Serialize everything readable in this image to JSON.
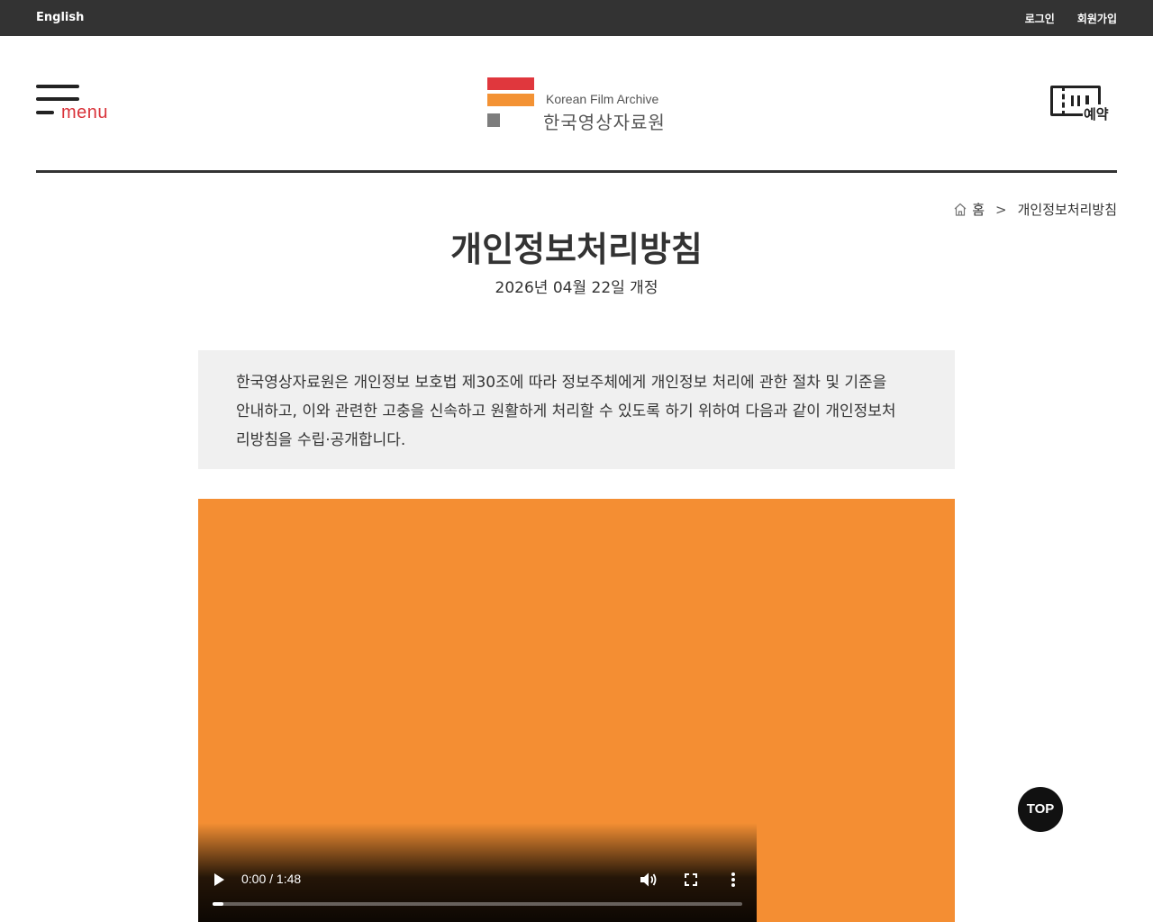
{
  "topbar": {
    "language_link": "English",
    "login": "로그인",
    "signup": "회원가입"
  },
  "header": {
    "menu_label": "menu",
    "logo_en": "Korean Film Archive",
    "logo_ko": "한국영상자료원",
    "reserve_label": "예약",
    "colors": {
      "brand_red": "#e0373d",
      "brand_orange": "#f39234",
      "logo_gray": "#7d7d7d"
    }
  },
  "breadcrumb": {
    "home": "홈",
    "separator": ">",
    "current": "개인정보처리방침"
  },
  "page": {
    "title": "개인정보처리방침",
    "revision_date": "2026년 04월 22일 개정",
    "intro_line1": "한국영상자료원은 개인정보 보호법 제30조에 따라 정보주체에게 개인정보 처리에 관한 절차 및 기준을",
    "intro_line2": "안내하고, 이와 관련한 고충을 신속하고 원활하게 처리할 수 있도록 하기 위하여 다음과 같이 개인정보처",
    "intro_line3": "리방침을 수립·공개합니다."
  },
  "video": {
    "time_display": "0:00 / 1:48",
    "progress_fraction": 0.02,
    "background_color": "#f48e33",
    "icons": [
      "play-icon",
      "volume-icon",
      "fullscreen-icon",
      "more-options-icon"
    ]
  },
  "top_button": "TOP"
}
